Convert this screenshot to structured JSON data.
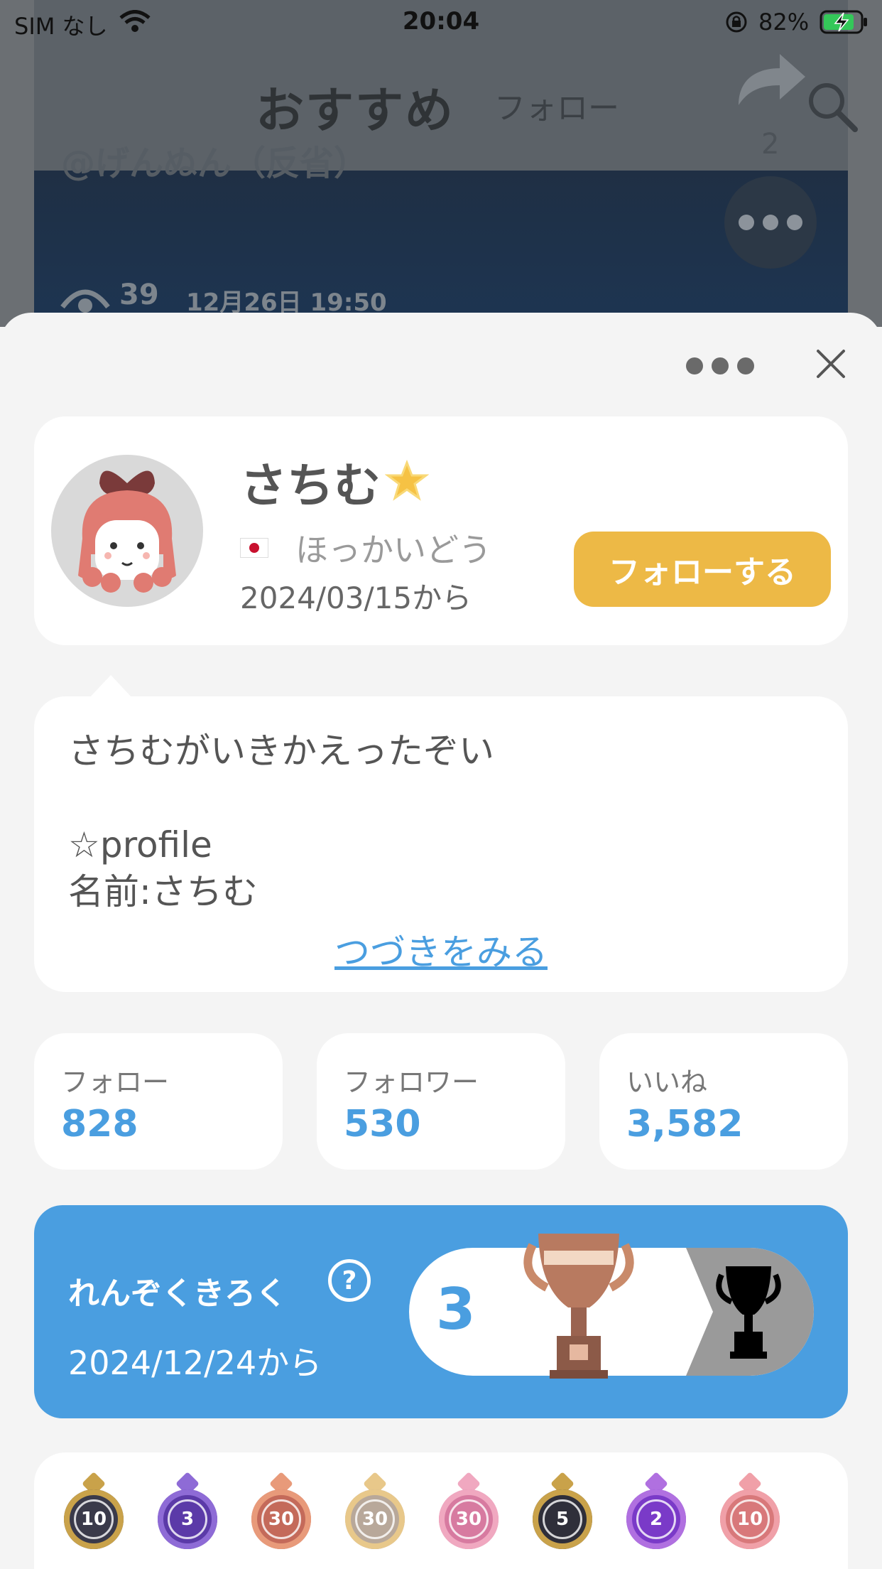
{
  "status_bar": {
    "carrier": "SIM なし",
    "time": "20:04",
    "battery": "82%"
  },
  "background": {
    "title": "おすすめ",
    "follow_tab": "フォロー",
    "user": "@げんぬん（反省）",
    "share_count": "2",
    "views": "39",
    "date": "12月26日 19:50"
  },
  "profile": {
    "name": "さちむ",
    "location": "ほっかいどう",
    "since": "2024/03/15から",
    "follow_button": "フォローする"
  },
  "bio": {
    "text": "さちむがいきかえったぞい\n\n☆profile\n名前:さちむ",
    "more_link": "つづきをみる"
  },
  "stats": [
    {
      "label": "フォロー",
      "value": "828"
    },
    {
      "label": "フォロワー",
      "value": "530"
    },
    {
      "label": "いいね",
      "value": "3,582"
    }
  ],
  "streak": {
    "title": "れんぞくきろく",
    "help": "?",
    "since": "2024/12/24から",
    "count": "3"
  },
  "badges": [
    {
      "num": "10",
      "color": "#3a3a4a",
      "crest": "#c9a24a"
    },
    {
      "num": "3",
      "color": "#5b3aa8",
      "crest": "#8e6bd6"
    },
    {
      "num": "30",
      "color": "#c46a5a",
      "crest": "#e89a7a"
    },
    {
      "num": "30",
      "color": "#b8a89a",
      "crest": "#e8c88a"
    },
    {
      "num": "30",
      "color": "#d77aa0",
      "crest": "#f0a8c0"
    },
    {
      "num": "5",
      "color": "#2f2f3a",
      "crest": "#c9a24a"
    },
    {
      "num": "2",
      "color": "#7a3ac8",
      "crest": "#b070e0"
    },
    {
      "num": "10",
      "color": "#d8787a",
      "crest": "#f0a0a8"
    }
  ],
  "colors": {
    "accent_blue": "#4a9ee0",
    "follow_button": "#edb946"
  }
}
